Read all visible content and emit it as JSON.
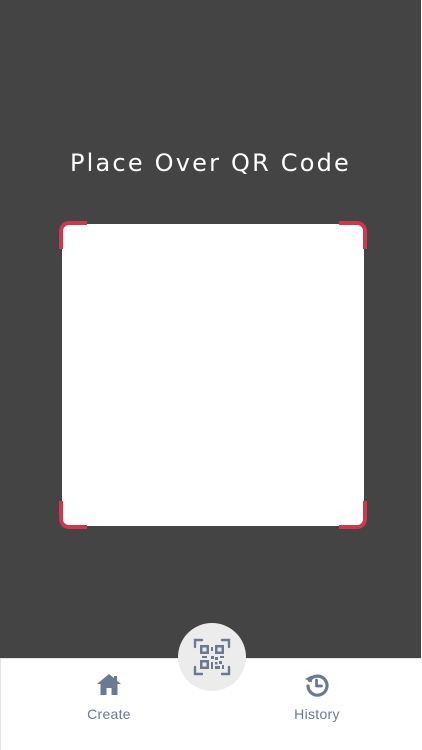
{
  "scanner": {
    "instruction": "Place Over QR Code",
    "frame_color": "#d1364f",
    "background_color": "#444444"
  },
  "tab_bar": {
    "create_label": "Create",
    "history_label": "History",
    "icon_color": "#6c7a91",
    "create_icon": "home-icon",
    "scan_icon": "qr-code-icon",
    "history_icon": "history-icon"
  }
}
